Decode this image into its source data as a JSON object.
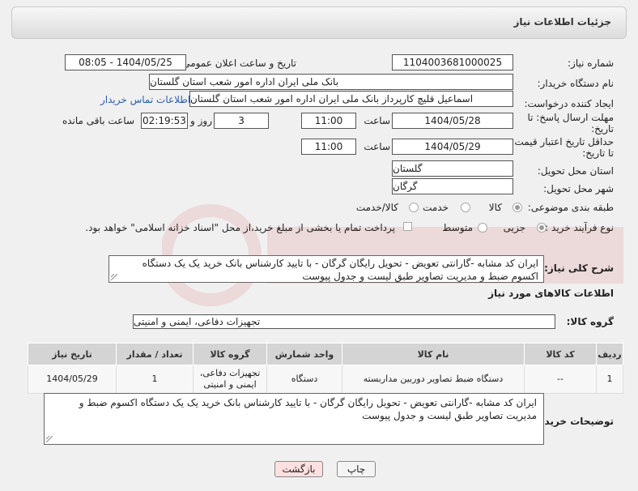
{
  "header": {
    "title": "جزئیات اطلاعات نیاز"
  },
  "form": {
    "need_number_label": "شماره نیاز:",
    "need_number": "1104003681000025",
    "announce_label": "تاریخ و ساعت اعلان عمومی:",
    "announce_value": "1404/05/25 - 08:05",
    "buyer_org_label": "نام دستگاه خریدار:",
    "buyer_org": "بانک ملی ایران اداره امور شعب استان گلستان",
    "requester_label": "ایجاد کننده درخواست:",
    "requester": "اسماعیل قلیچ کارپرداز بانک ملی ایران اداره امور شعب استان گلستان",
    "contact_link": "اطلاعات تماس خریدار",
    "deadline_label_1": "مهلت ارسال پاسخ: تا",
    "deadline_label_2": "تاریخ:",
    "deadline_date": "1404/05/28",
    "time_label": "ساعت",
    "deadline_time": "11:00",
    "days_value": "3",
    "days_label": "روز و",
    "remaining_value": "02:19:53",
    "remaining_label": "ساعت باقی مانده",
    "min_valid_label_1": "حداقل تاریخ اعتبار قیمت:",
    "min_valid_label_2": "تا تاریخ:",
    "valid_date": "1404/05/29",
    "valid_time": "11:00",
    "province_label": "استان محل تحویل:",
    "province": "گلستان",
    "city_label": "شهر محل تحویل:",
    "city": "گرگان",
    "category_label": "طبقه بندی موضوعی:",
    "category_options": [
      "کالا",
      "خدمت",
      "کالا/خدمت"
    ],
    "process_label": "نوع فرآیند خرید :",
    "process_options": [
      "جزیی",
      "متوسط"
    ],
    "payment_note": "پرداخت تمام یا بخشی از مبلغ خرید،از محل \"اسناد خزانه اسلامی\" خواهد بود.",
    "description_label": "شرح کلی نیاز:",
    "description": "ایران کد مشابه -گارانتی تعویض - تحویل رایگان گرگان - با تایید کارشناس بانک خرید یک یک دستگاه اکسوم ضبط و مدیریت تصاویر طبق لیست و جدول پیوست",
    "goods_info_title": "اطلاعات کالاهای مورد نیاز",
    "goods_group_label": "گروه کالا:",
    "goods_group": "تجهیزات دفاعی، ایمنی و امنیتی"
  },
  "table": {
    "headers": [
      "ردیف",
      "کد کالا",
      "نام کالا",
      "واحد شمارش",
      "گروه کالا",
      "تعداد / مقدار",
      "تاریخ نیاز"
    ],
    "rows": [
      [
        "1",
        "--",
        "دستگاه ضبط تصاویر دوربین مداربسته",
        "دستگاه",
        "تجهیزات دفاعی، ایمنی و امنیتی",
        "1",
        "1404/05/29"
      ]
    ]
  },
  "buyer_notes": {
    "label": "توضیحات خریدار:",
    "text": "ایران کد مشابه -گارانتی تعویض - تحویل رایگان گرگان - با تایید کارشناس بانک خرید یک یک دستگاه اکسوم ضبط و مدیریت تصاویر طبق لیست و جدول پیوست"
  },
  "buttons": {
    "print": "چاپ",
    "back": "بازگشت"
  },
  "colors": {
    "link": "#2a5db0",
    "back_button_bg": "#ffe0e0",
    "print_button_bg": "#f4f4f4"
  }
}
